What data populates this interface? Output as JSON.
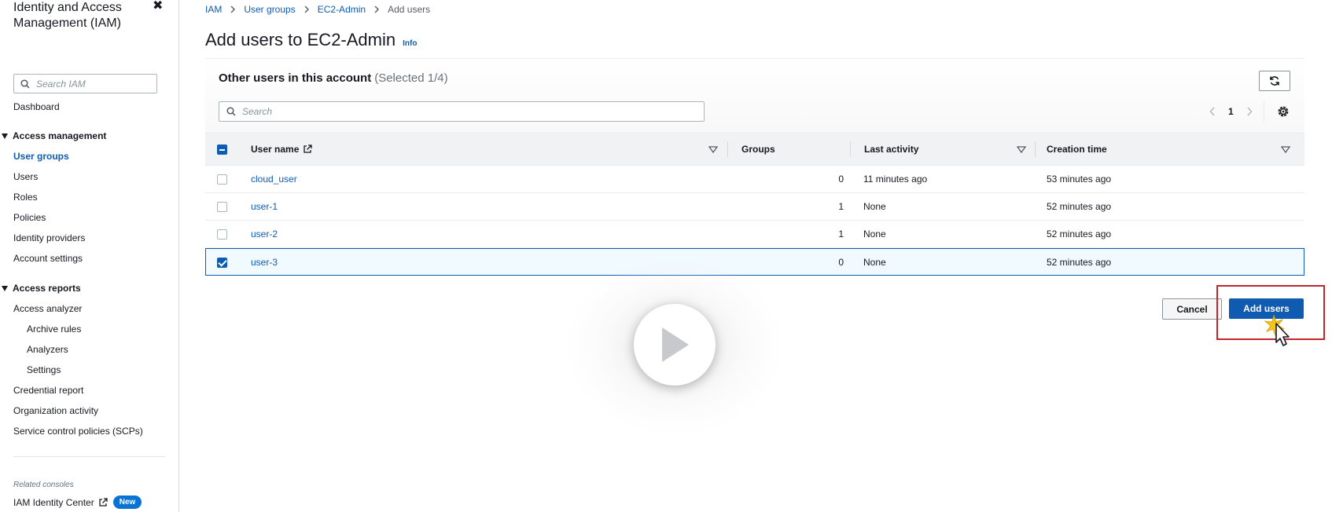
{
  "sidebar": {
    "title": "Identity and Access Management (IAM)",
    "close_icon": "close-icon",
    "search_placeholder": "Search IAM",
    "dashboard": "Dashboard",
    "access_management": {
      "label": "Access management",
      "items": [
        "User groups",
        "Users",
        "Roles",
        "Policies",
        "Identity providers",
        "Account settings"
      ],
      "active": "User groups"
    },
    "access_reports": {
      "label": "Access reports",
      "items": [
        "Access analyzer",
        "Archive rules",
        "Analyzers",
        "Settings",
        "Credential report",
        "Organization activity",
        "Service control policies (SCPs)"
      ]
    },
    "related_consoles_label": "Related consoles",
    "identity_center": "IAM Identity Center",
    "new_badge": "New"
  },
  "breadcrumb": [
    "IAM",
    "User groups",
    "EC2-Admin",
    "Add users"
  ],
  "page": {
    "title": "Add users to EC2-Admin",
    "info_link": "Info"
  },
  "panel": {
    "title": "Other users in this account",
    "selected_count": "(Selected 1/4)",
    "search_placeholder": "Search",
    "page_number": "1"
  },
  "table": {
    "columns": [
      "User name",
      "Groups",
      "Last activity",
      "Creation time"
    ],
    "rows": [
      {
        "user_name": "cloud_user",
        "groups": "0",
        "last_activity": "11 minutes ago",
        "creation_time": "53 minutes ago",
        "selected": false
      },
      {
        "user_name": "user-1",
        "groups": "1",
        "last_activity": "None",
        "creation_time": "52 minutes ago",
        "selected": false
      },
      {
        "user_name": "user-2",
        "groups": "1",
        "last_activity": "None",
        "creation_time": "52 minutes ago",
        "selected": false
      },
      {
        "user_name": "user-3",
        "groups": "0",
        "last_activity": "None",
        "creation_time": "52 minutes ago",
        "selected": true
      }
    ]
  },
  "actions": {
    "cancel": "Cancel",
    "add_users": "Add users"
  },
  "colors": {
    "link_blue": "#0f5bb2",
    "primary_button": "#0f5bb2",
    "highlight_red": "#c0262d",
    "new_badge": "#0972d3"
  },
  "overlay": {
    "icon": "play-icon"
  }
}
